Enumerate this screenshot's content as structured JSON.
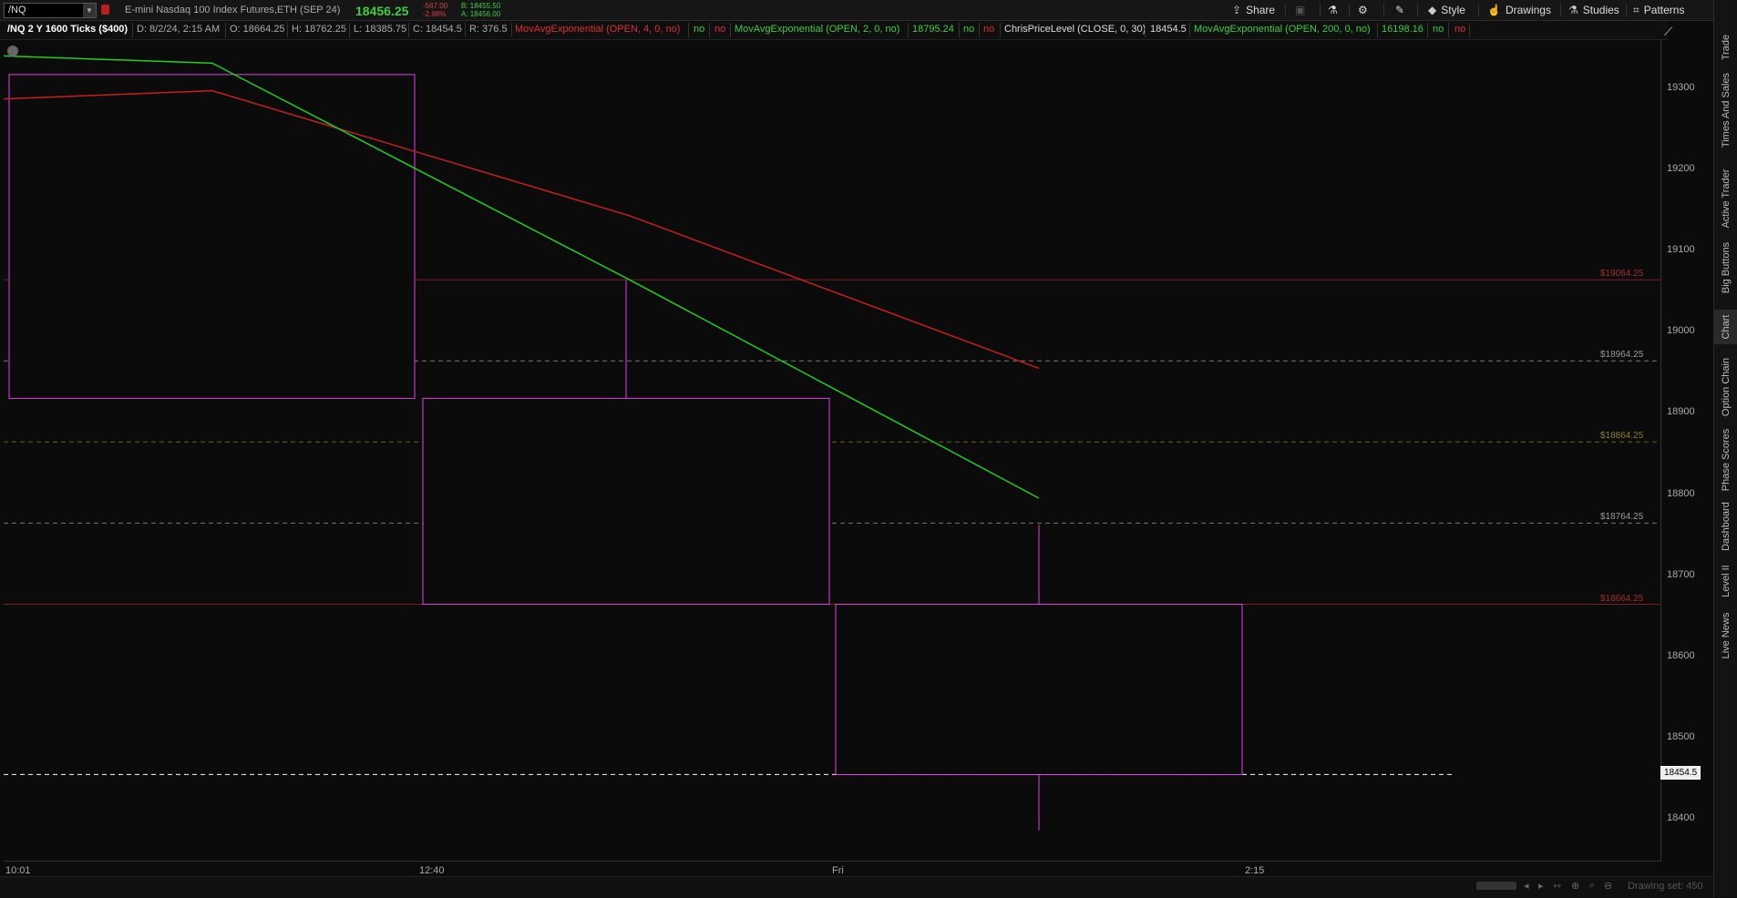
{
  "topbar": {
    "symbol": "/NQ",
    "description": "E-mini Nasdaq 100 Index Futures,ETH (SEP 24)",
    "last": "18456.25",
    "change": "-567.00",
    "change_pct": "-2.98%",
    "bid": "B: 18455.50",
    "ask": "A: 18456.00",
    "share_label": "Share",
    "style_label": "Style",
    "drawings_label": "Drawings",
    "studies_label": "Studies",
    "patterns_label": "Patterns"
  },
  "infobar": {
    "chart_title": "/NQ 2 Y 1600 Ticks ($400)",
    "date": "D: 8/2/24, 2:15 AM",
    "open": "O: 18664.25",
    "high": "H: 18762.25",
    "low": "L: 18385.75",
    "close": "C: 18454.5",
    "range": "R: 376.5",
    "study1_label": "MovAvgExponential (OPEN, 4, 0, no)",
    "study1_v1": "no",
    "study1_v2": "no",
    "study2_label": "MovAvgExponential (OPEN, 2, 0, no)",
    "study2_value": "18795.24",
    "study2_v1": "no",
    "study2_v2": "no",
    "study3_label": "ChrisPriceLevel (CLOSE, 0, 30)",
    "study3_value": "18454.5",
    "study4_label": "MovAvgExponential (OPEN, 200, 0, no)",
    "study4_value": "16198.16",
    "study4_v1": "no",
    "study4_v2": "no"
  },
  "colors": {
    "red_line": "#c81e1e",
    "green_line": "#22cc22",
    "candle": "#e040e0",
    "level_red": "#7a2020",
    "level_gray": "#777777",
    "level_olive": "#6f5f20"
  },
  "chart_data": {
    "type": "candlestick",
    "y_ticks": [
      "19300",
      "19200",
      "19100",
      "19000",
      "18900",
      "18800",
      "18700",
      "18600",
      "18500",
      "18400"
    ],
    "x_ticks": [
      "10:01",
      "12:40",
      "Fri",
      "2:15"
    ],
    "candles": [
      {
        "open": 19317,
        "high": 19317,
        "low": 18918,
        "close": 18918
      },
      {
        "open": 18918,
        "high": 19064.25,
        "low": 18664.25,
        "close": 18664.25
      },
      {
        "open": 18664.25,
        "high": 18762.25,
        "low": 18385.75,
        "close": 18454.5
      }
    ],
    "series": [
      {
        "name": "MovAvgExponential (OPEN, 4, 0, no)",
        "color": "red",
        "values": [
          19297,
          19143,
          18955
        ]
      },
      {
        "name": "MovAvgExponential (OPEN, 2, 0, no)",
        "color": "green",
        "values": [
          19331,
          19064,
          18795
        ]
      }
    ],
    "price_levels": [
      {
        "label": "$19064.25",
        "value": 19064.25,
        "style": "solid",
        "color": "red"
      },
      {
        "label": "$18964.25",
        "value": 18964.25,
        "style": "dashed",
        "color": "gray"
      },
      {
        "label": "$18864.25",
        "value": 18864.25,
        "style": "dashed",
        "color": "olive"
      },
      {
        "label": "$18764.25",
        "value": 18764.25,
        "style": "dashed",
        "color": "gray"
      },
      {
        "label": "$18664.25",
        "value": 18664.25,
        "style": "solid",
        "color": "red"
      }
    ],
    "last_price_label": "18454.5",
    "last_price": 18454.5,
    "ylim": [
      18350,
      19370
    ]
  },
  "sidebar": {
    "tabs": [
      "Trade",
      "Times And Sales",
      "Active Trader",
      "Big Buttons",
      "Chart",
      "Option Chain",
      "Phase Scores",
      "Dashboard",
      "Level II",
      "Live News"
    ]
  },
  "bottombar": {
    "drawing_set": "Drawing set: 450"
  }
}
